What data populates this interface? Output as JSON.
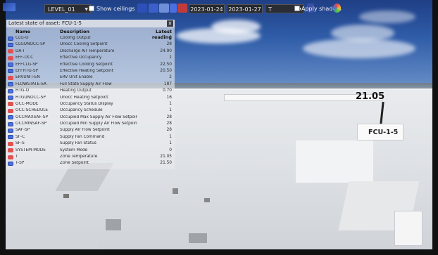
{
  "toolbar": {
    "level_select": "LEVEL_01",
    "show_ceilings_label": "Show ceilings",
    "start_date": "2023-01-24",
    "end_date": "2023-01-27",
    "interval_select": "T",
    "apply_shaders_label": "Apply shaders",
    "icons": [
      "app-logo-icon",
      "grid-view-icon",
      "image-icon",
      "cube-icon",
      "sensor-icon",
      "calendar-icon",
      "color-swatch-icon",
      "shader-icon"
    ]
  },
  "panel": {
    "title": "Latest state of asset: FCU-1-5",
    "close_label": "x",
    "columns": {
      "name": "Name",
      "description": "Description",
      "reading": "Latest reading"
    },
    "rows": [
      {
        "icon": "monitor",
        "name": "CLG-O",
        "description": "Cooling Output",
        "reading": "0"
      },
      {
        "icon": "monitor",
        "name": "CLGUNOCC-SP",
        "description": "Unocc Cooling Setpoint",
        "reading": "28"
      },
      {
        "icon": "chart",
        "name": "DA-T",
        "description": "Discharge Air Temperature",
        "reading": "24.90"
      },
      {
        "icon": "chart",
        "name": "EFF-OCC",
        "description": "Effective Occupancy",
        "reading": "1"
      },
      {
        "icon": "monitor",
        "name": "EFFCLG-SP",
        "description": "Effective Cooling Setpoint",
        "reading": "22.50"
      },
      {
        "icon": "monitor",
        "name": "EFFHTG-SP",
        "description": "Effective Heating Setpoint",
        "reading": "20.50"
      },
      {
        "icon": "chart",
        "name": "ERVUNIT-EN",
        "description": "ERV Unit Enable",
        "reading": "2"
      },
      {
        "icon": "monitor",
        "name": "FLOWSTATE-SA",
        "description": "Full State Supply Air Flow",
        "reading": "187"
      },
      {
        "icon": "monitor",
        "name": "HTG-O",
        "description": "Heating Output",
        "reading": "0.70"
      },
      {
        "icon": "monitor",
        "name": "HTGUNOCC-SP",
        "description": "Unocc Heating Setpoint",
        "reading": "16"
      },
      {
        "icon": "chart",
        "name": "OCC-MODE",
        "description": "Occupancy Status Display",
        "reading": "1"
      },
      {
        "icon": "chart",
        "name": "OCC-SCHEDULE",
        "description": "Occupancy Schedule",
        "reading": "1"
      },
      {
        "icon": "monitor",
        "name": "OCCMAXSAF-SP",
        "description": "Occupied Max Supply Air Flow Setpoint",
        "reading": "28"
      },
      {
        "icon": "monitor",
        "name": "OCCMINSAF-SP",
        "description": "Occupied Min Supply Air Flow Setpoint",
        "reading": "28"
      },
      {
        "icon": "monitor",
        "name": "SAF-SP",
        "description": "Supply Air Flow Setpoint",
        "reading": "28"
      },
      {
        "icon": "monitor",
        "name": "SF-C",
        "description": "Supply Fan Command",
        "reading": "1"
      },
      {
        "icon": "chart",
        "name": "SF-S",
        "description": "Supply Fan Status",
        "reading": "1"
      },
      {
        "icon": "chart",
        "name": "SYSTEM-MODE",
        "description": "System Mode",
        "reading": "0"
      },
      {
        "icon": "chart",
        "name": "T",
        "description": "Zone Temperature",
        "reading": "21.05"
      },
      {
        "icon": "monitor",
        "name": "T-SP",
        "description": "Zone Setpoint",
        "reading": "21.50"
      }
    ]
  },
  "scene": {
    "asset_label": "FCU-1-5",
    "asset_reading": "21.05"
  },
  "colors": {
    "sky_top": "#1f3f86",
    "roof": "#e2e4e7",
    "panel_bg": "#e8eaee",
    "monitor_icon": "#4a6fe0",
    "chart_icon": "#e35151"
  }
}
